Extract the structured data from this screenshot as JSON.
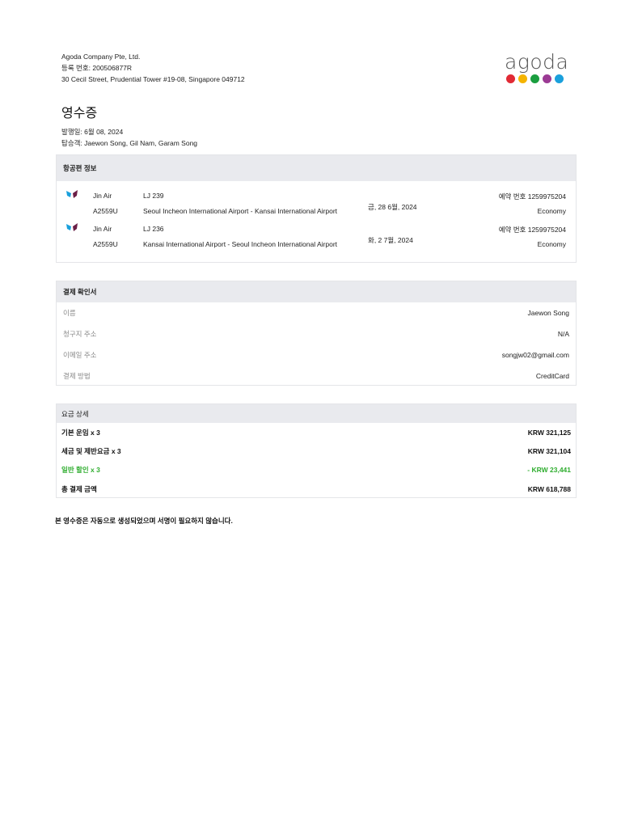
{
  "company": {
    "name": "Agoda Company Pte, Ltd.",
    "registration": "등록 번호: 200506877R",
    "address": "30 Cecil Street, Prudential Tower #19-08, Singapore 049712"
  },
  "logo": {
    "text": "agoda",
    "dot_colors": [
      "#e12a35",
      "#f5b400",
      "#1a9e3f",
      "#9b3a94",
      "#1aa0dc"
    ]
  },
  "title": "영수증",
  "issue_date": "발행일: 6월 08, 2024",
  "passengers": "탑승객: Jaewon Song, Gil Nam, Garam Song",
  "flights": {
    "header": "항공편 정보",
    "items": [
      {
        "airline": "Jin Air",
        "code": "A2559U",
        "flight": "LJ 239",
        "route": "Seoul Incheon International Airport - Kansai International Airport",
        "date": "금, 28 6월, 2024",
        "booking": "예약 번호 1259975204",
        "cabin": "Economy"
      },
      {
        "airline": "Jin Air",
        "code": "A2559U",
        "flight": "LJ 236",
        "route": "Kansai International Airport - Seoul Incheon International Airport",
        "date": "화, 2 7월, 2024",
        "booking": "예약 번호 1259975204",
        "cabin": "Economy"
      }
    ]
  },
  "payment": {
    "header": "결제 확인서",
    "rows": [
      {
        "label": "이름",
        "value": "Jaewon Song"
      },
      {
        "label": "청구지 주소",
        "value": "N/A"
      },
      {
        "label": "이메일 주소",
        "value": "songjw02@gmail.com"
      },
      {
        "label": "결제 방법",
        "value": "CreditCard"
      }
    ]
  },
  "fare": {
    "header": "요금 상세",
    "rows": [
      {
        "label": "기본 운임 x 3",
        "value": "KRW 321,125"
      },
      {
        "label": "세금 및 제반요금 x 3",
        "value": "KRW 321,104"
      },
      {
        "label": "일반 할인 x 3",
        "value": "- KRW 23,441"
      },
      {
        "label": "총 결제 금액",
        "value": "KRW 618,788"
      }
    ]
  },
  "footer": "본 영수증은 자동으로 생성되었으며 서명이 필요하지 않습니다."
}
